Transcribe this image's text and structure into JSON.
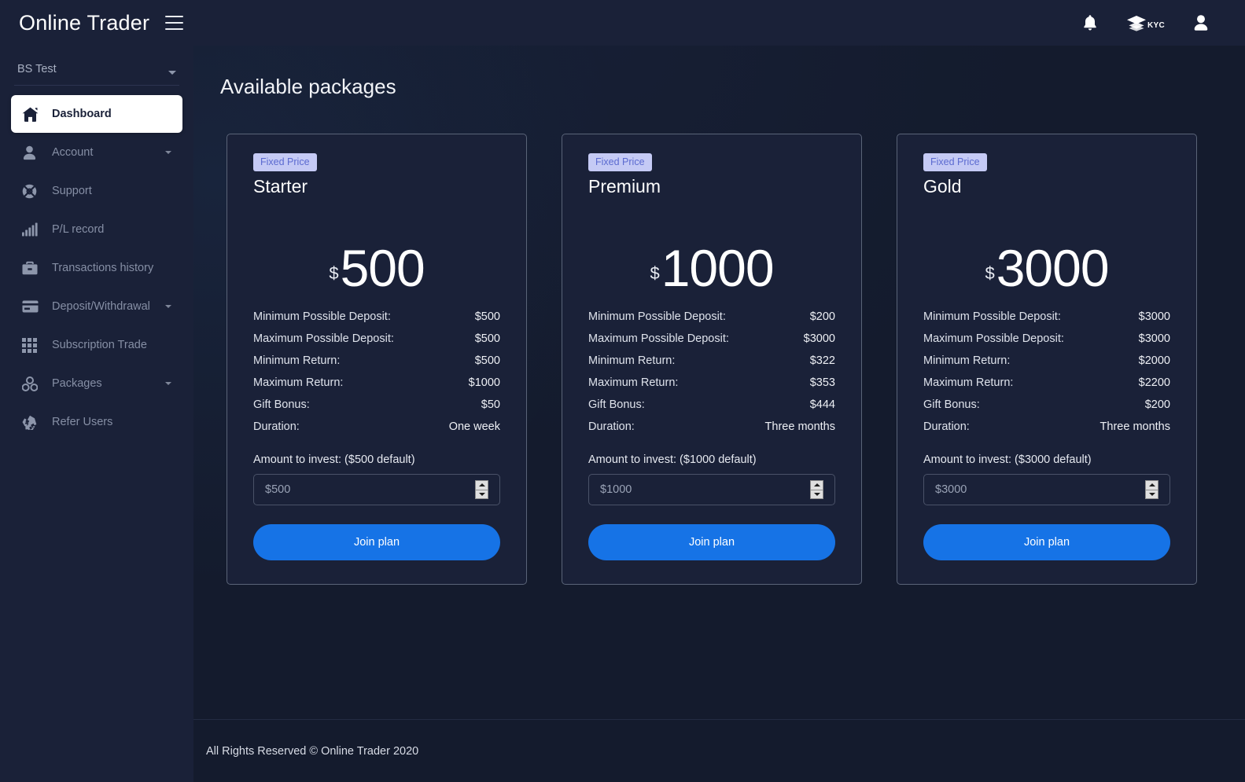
{
  "topbar": {
    "brand": "Online Trader",
    "menu_icon": "hamburger-icon",
    "notifications_icon": "bell-icon",
    "kyc_icon": "layers-icon",
    "kyc_label": "KYC",
    "profile_icon": "user-icon"
  },
  "sidebar": {
    "account_selector": "BS Test",
    "items": [
      {
        "label": "Dashboard",
        "icon": "home-icon",
        "active": true,
        "expandable": false
      },
      {
        "label": "Account",
        "icon": "person-icon",
        "active": false,
        "expandable": true
      },
      {
        "label": "Support",
        "icon": "lifebuoy-icon",
        "active": false,
        "expandable": false
      },
      {
        "label": "P/L record",
        "icon": "bar-chart-icon",
        "active": false,
        "expandable": false
      },
      {
        "label": "Transactions history",
        "icon": "briefcase-icon",
        "active": false,
        "expandable": false
      },
      {
        "label": "Deposit/Withdrawal",
        "icon": "credit-card-icon",
        "active": false,
        "expandable": true
      },
      {
        "label": "Subscription Trade",
        "icon": "grid-icon",
        "active": false,
        "expandable": false
      },
      {
        "label": "Packages",
        "icon": "molecule-icon",
        "active": false,
        "expandable": true
      },
      {
        "label": "Refer Users",
        "icon": "recycle-icon",
        "active": false,
        "expandable": false
      }
    ]
  },
  "main": {
    "page_title": "Available packages",
    "spec_labels": [
      "Minimum Possible Deposit:",
      "Maximum Possible Deposit:",
      "Minimum Return:",
      "Maximum Return:",
      "Gift Bonus:",
      "Duration:"
    ],
    "join_label": "Join plan",
    "currency_symbol": "$",
    "packages": [
      {
        "badge": "Fixed Price",
        "name": "Starter",
        "price": "500",
        "specs": [
          "$500",
          "$500",
          "$500",
          "$1000",
          "$50",
          "One week"
        ],
        "invest_label": "Amount to invest: ($500 default)",
        "invest_value": "$500"
      },
      {
        "badge": "Fixed Price",
        "name": "Premium",
        "price": "1000",
        "specs": [
          "$200",
          "$3000",
          "$322",
          "$353",
          "$444",
          "Three months"
        ],
        "invest_label": "Amount to invest: ($1000 default)",
        "invest_value": "$1000"
      },
      {
        "badge": "Fixed Price",
        "name": "Gold",
        "price": "3000",
        "specs": [
          "$3000",
          "$3000",
          "$2000",
          "$2200",
          "$200",
          "Three months"
        ],
        "invest_label": "Amount to invest: ($3000 default)",
        "invest_value": "$3000"
      }
    ]
  },
  "footer": {
    "text": "All Rights Reserved © Online Trader 2020"
  },
  "colors": {
    "accent": "#1673e6",
    "panel": "#1a2138",
    "page_bg": "#141b2d",
    "badge_bg": "#c5caf5",
    "badge_fg": "#5b6ad0"
  }
}
